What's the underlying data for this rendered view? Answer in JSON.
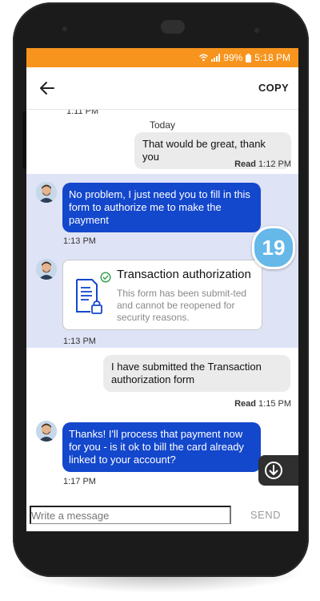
{
  "status_bar": {
    "battery": "99%",
    "time": "5:18 PM"
  },
  "top_bar": {
    "copy_label": "COPY"
  },
  "chat": {
    "cut_off_time": "1:11 PM",
    "day_separator": "Today",
    "messages": [
      {
        "text": "That would be great, thank you",
        "read_label": "Read",
        "time": "1:12 PM"
      },
      {
        "text": "No problem, I just need you to fill in this form to authorize me to make the payment",
        "time": "1:13 PM"
      },
      {
        "time": "1:13 PM"
      },
      {
        "text": "I have submitted the Transaction authorization form",
        "read_label": "Read",
        "time": "1:15 PM"
      },
      {
        "text": "Thanks! I'll process that payment now for you - is it ok to bill the card already linked to your account?",
        "time": "1:17 PM"
      }
    ],
    "form_card": {
      "title": "Transaction authorization",
      "body": "This form has been submit-ted and cannot be reopened for security reasons."
    }
  },
  "badge": "19",
  "composer": {
    "placeholder": "Write a message",
    "send_label": "SEND"
  },
  "colors": {
    "status_bar": "#f7941d",
    "agent_bubble": "#1347cc",
    "highlight": "#dfe3f6",
    "badge": "#65b8e8"
  }
}
